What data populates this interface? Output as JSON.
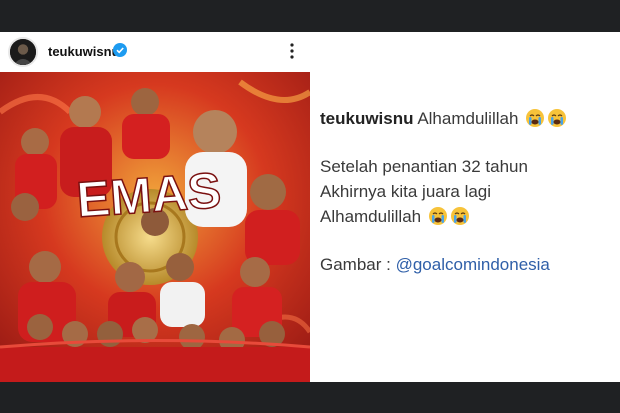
{
  "header": {
    "username": "teukuwisnu",
    "verified_icon": "verified-badge-icon",
    "more_icon": "more-options-icon"
  },
  "post": {
    "overlay_text": "EMAS"
  },
  "caption": {
    "username": "teukuwisnu",
    "first_line": "Alhamdulillah",
    "line2": "Setelah penantian 32 tahun",
    "line3": "Akhirnya kita juara lagi",
    "line4": "Alhamdulillah",
    "credit_label": "Gambar :",
    "credit_mention": "@goalcomindonesia",
    "emoji": "crying-face-icon"
  },
  "colors": {
    "background": "#1f2123",
    "accent_red": "#c8231e",
    "mention": "#2f5fa8",
    "verified": "#1d9bf0"
  }
}
